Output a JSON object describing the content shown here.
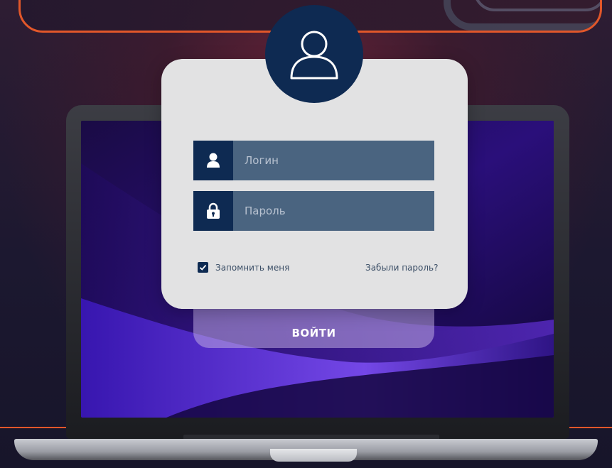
{
  "form": {
    "login_placeholder": "Логин",
    "password_placeholder": "Пароль",
    "remember_label": "Запомнить меня",
    "remember_checked": true,
    "forgot_label": "Забыли пароль?",
    "submit_label": "ВОЙТИ"
  },
  "icons": {
    "avatar": "user-avatar-icon",
    "login_field": "user-icon",
    "password_field": "lock-icon",
    "checkbox": "checkmark-icon"
  },
  "colors": {
    "accent_navy": "#0e2a52",
    "field_bg": "#4a6480",
    "card_bg": "#e2e2e3",
    "border_orange": "#e2572a"
  }
}
